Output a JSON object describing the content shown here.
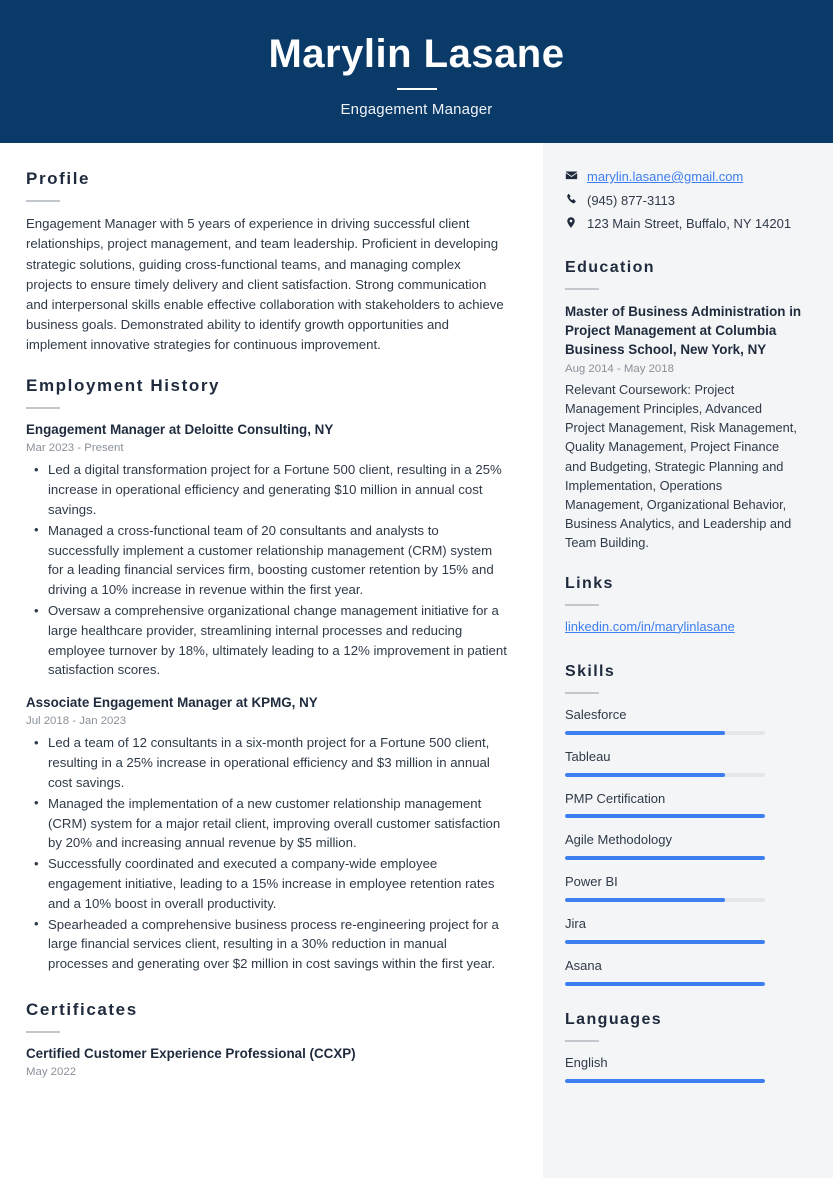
{
  "header": {
    "name": "Marylin Lasane",
    "title": "Engagement Manager"
  },
  "colors": {
    "header_bg": "#0A3A67",
    "sidebar_bg": "#F4F5F7",
    "accent_blue": "#3D7EF0",
    "heading": "#1F2B3D",
    "muted": "#8A9199"
  },
  "main": {
    "profile": {
      "heading": "Profile",
      "text": "Engagement Manager with 5 years of experience in driving successful client relationships, project management, and team leadership. Proficient in developing strategic solutions, guiding cross-functional teams, and managing complex projects to ensure timely delivery and client satisfaction. Strong communication and interpersonal skills enable effective collaboration with stakeholders to achieve business goals. Demonstrated ability to identify growth opportunities and implement innovative strategies for continuous improvement."
    },
    "employment": {
      "heading": "Employment History",
      "jobs": [
        {
          "title": "Engagement Manager at Deloitte Consulting, NY",
          "date": "Mar 2023 - Present",
          "bullets": [
            "Led a digital transformation project for a Fortune 500 client, resulting in a 25% increase in operational efficiency and generating $10 million in annual cost savings.",
            "Managed a cross-functional team of 20 consultants and analysts to successfully implement a customer relationship management (CRM) system for a leading financial services firm, boosting customer retention by 15% and driving a 10% increase in revenue within the first year.",
            "Oversaw a comprehensive organizational change management initiative for a large healthcare provider, streamlining internal processes and reducing employee turnover by 18%, ultimately leading to a 12% improvement in patient satisfaction scores."
          ]
        },
        {
          "title": "Associate Engagement Manager at KPMG, NY",
          "date": "Jul 2018 - Jan 2023",
          "bullets": [
            "Led a team of 12 consultants in a six-month project for a Fortune 500 client, resulting in a 25% increase in operational efficiency and $3 million in annual cost savings.",
            "Managed the implementation of a new customer relationship management (CRM) system for a major retail client, improving overall customer satisfaction by 20% and increasing annual revenue by $5 million.",
            "Successfully coordinated and executed a company-wide employee engagement initiative, leading to a 15% increase in employee retention rates and a 10% boost in overall productivity.",
            "Spearheaded a comprehensive business process re-engineering project for a large financial services client, resulting in a 30% reduction in manual processes and generating over $2 million in cost savings within the first year."
          ]
        }
      ]
    },
    "certificates": {
      "heading": "Certificates",
      "items": [
        {
          "title": "Certified Customer Experience Professional (CCXP)",
          "date": "May 2022"
        }
      ]
    }
  },
  "sidebar": {
    "contact": [
      {
        "icon": "envelope-icon",
        "text": "marylin.lasane@gmail.com",
        "is_link": true
      },
      {
        "icon": "phone-icon",
        "text": "(945) 877-3113",
        "is_link": false
      },
      {
        "icon": "location-pin-icon",
        "text": "123 Main Street, Buffalo, NY 14201",
        "is_link": false
      }
    ],
    "education": {
      "heading": "Education",
      "degree": "Master of Business Administration in Project Management at Columbia Business School, New York, NY",
      "date": "Aug 2014 - May 2018",
      "description": "Relevant Coursework: Project Management Principles, Advanced Project Management, Risk Management, Quality Management, Project Finance and Budgeting, Strategic Planning and Implementation, Operations Management, Organizational Behavior, Business Analytics, and Leadership and Team Building."
    },
    "links": {
      "heading": "Links",
      "items": [
        {
          "text": "linkedin.com/in/marylinlasane"
        }
      ]
    },
    "skills": {
      "heading": "Skills",
      "items": [
        {
          "label": "Salesforce",
          "level": 80
        },
        {
          "label": "Tableau",
          "level": 80
        },
        {
          "label": "PMP Certification",
          "level": 100
        },
        {
          "label": "Agile Methodology",
          "level": 100
        },
        {
          "label": "Power BI",
          "level": 80
        },
        {
          "label": "Jira",
          "level": 100
        },
        {
          "label": "Asana",
          "level": 100
        }
      ]
    },
    "languages": {
      "heading": "Languages",
      "items": [
        {
          "label": "English",
          "level": 100
        }
      ]
    }
  }
}
